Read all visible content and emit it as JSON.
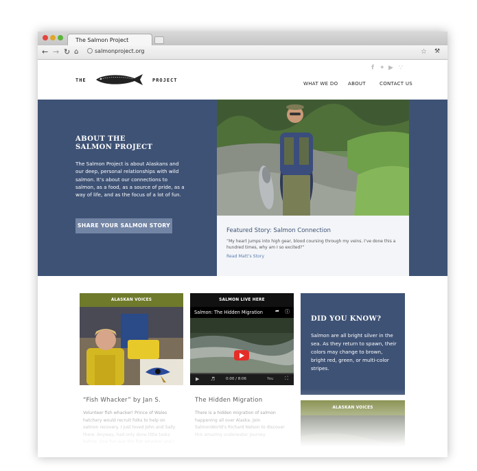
{
  "browser": {
    "tab_title": "The Salmon Project",
    "url": "salmonproject.org"
  },
  "header": {
    "logo_left": "THE",
    "logo_right": "PROJECT",
    "nav": [
      "WHAT WE DO",
      "ABOUT",
      "CONTACT US"
    ]
  },
  "hero": {
    "title_line1": "ABOUT THE",
    "title_line2": "SALMON PROJECT",
    "body": "The Salmon Project is about Alaskans and our deep, personal relationships with wild salmon. It’s about our connections to salmon, as a food, as a source of pride, as a way of life, and as the focus of a lot of fun.",
    "button": "SHARE YOUR SALMON STORY"
  },
  "featured": {
    "title": "Featured Story: Salmon Connection",
    "quote": "“My heart jumps into high gear, blood coursing through my veins. I’ve done this a hundred times, why am I so excited?”",
    "link": "Read Matt’s Story"
  },
  "cards": {
    "voices": {
      "header": "ALASKAN VOICES",
      "title": "“Fish Whacker” by Jan S.",
      "text": "Volunteer fish whacker! Prince of Wales hatchery would recruit folks to help on salmon recovery. I just loved John and Sally there. Anyway, had only done little tasks before. One fun was the fish whacker and I was"
    },
    "live": {
      "header": "SALMON LIVE HERE",
      "video_title": "Salmon: The Hidden Migration",
      "video_time": "0:00 / 8:06",
      "title": "The Hidden Migration",
      "text": "There is a hidden migration of salmon happening all over Alaska. Join SalmonWorld’s Richard Nelson to discover this amazing underwater journey."
    },
    "did_you_know": {
      "title": "DID YOU KNOW?",
      "body": "Salmon are all bright silver in the sea. As they return to spawn, their colors may change to brown, bright red, green, or multi-color stripes."
    },
    "voices2": {
      "header": "ALASKAN VOICES"
    }
  },
  "colors": {
    "navy": "#3e5275",
    "olive": "#6f7a2b",
    "button": "#7385a5"
  }
}
